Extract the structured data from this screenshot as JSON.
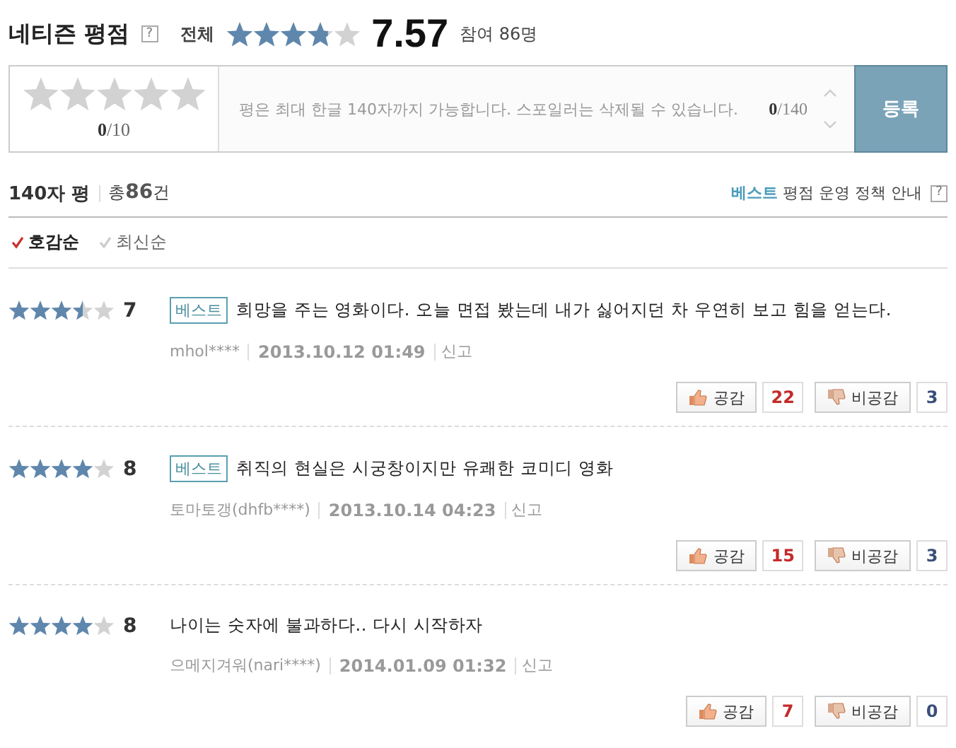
{
  "header": {
    "title": "네티즌 평점",
    "help": "?",
    "overall_label": "전체",
    "stars": 3.785,
    "score": "7.57",
    "participants": "참여 86명"
  },
  "form": {
    "stars": 0,
    "rating_value": "0",
    "rating_max": "/10",
    "placeholder": "평은 최대 한글 140자까지 가능합니다. 스포일러는 삭제될 수 있습니다.",
    "count_value": "0",
    "count_max": "/140",
    "submit": "등록"
  },
  "list_header": {
    "title": "140자 평",
    "total_prefix": "총",
    "total_count": "86",
    "total_suffix": "건",
    "policy_best": "베스트",
    "policy_rest": "평점 운영 정책 안내",
    "policy_help": "?"
  },
  "sort_options": [
    {
      "label": "호감순",
      "selected": true
    },
    {
      "label": "최신순",
      "selected": false
    }
  ],
  "reviews": [
    {
      "stars": 3.5,
      "score": "7",
      "best": true,
      "best_label": "베스트",
      "text": "희망을 주는 영화이다. 오늘 면접 봤는데 내가 싫어지던 차 우연히 보고 힘을 얻는다.",
      "author": "mhol****",
      "date": "2013.10.12 01:49",
      "report": "신고",
      "agree_label": "공감",
      "agree": "22",
      "disagree_label": "비공감",
      "disagree": "3"
    },
    {
      "stars": 4,
      "score": "8",
      "best": true,
      "best_label": "베스트",
      "text": "취직의 현실은 시궁창이지만 유쾌한 코미디 영화",
      "author": "토마토갱(dhfb****)",
      "date": "2013.10.14 04:23",
      "report": "신고",
      "agree_label": "공감",
      "agree": "15",
      "disagree_label": "비공감",
      "disagree": "3"
    },
    {
      "stars": 4,
      "score": "8",
      "best": false,
      "text": "나이는 숫자에 불과하다.. 다시 시작하자",
      "author": "으메지겨워(nari****)",
      "date": "2014.01.09 01:32",
      "report": "신고",
      "agree_label": "공감",
      "agree": "7",
      "disagree_label": "비공감",
      "disagree": "0"
    }
  ]
}
